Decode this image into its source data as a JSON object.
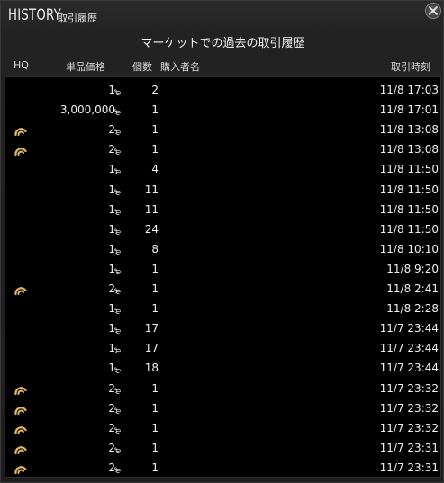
{
  "window": {
    "title": "HISTORY",
    "subtitle": "取引履歴",
    "heading": "マーケットでの過去の取引履歴"
  },
  "columns": {
    "hq": "HQ",
    "price": "単品価格",
    "quantity": "個数",
    "buyer": "購入者名",
    "date": "取引時刻"
  },
  "currency_symbol": "₻",
  "rows": [
    {
      "hq": false,
      "price": "1",
      "qty": "2",
      "date": "11/8 17:03"
    },
    {
      "hq": false,
      "price": "3,000,000",
      "qty": "1",
      "date": "11/8 17:01"
    },
    {
      "hq": true,
      "price": "2",
      "qty": "1",
      "date": "11/8 13:08"
    },
    {
      "hq": true,
      "price": "2",
      "qty": "1",
      "date": "11/8 13:08"
    },
    {
      "hq": false,
      "price": "1",
      "qty": "4",
      "date": "11/8 11:50"
    },
    {
      "hq": false,
      "price": "1",
      "qty": "11",
      "date": "11/8 11:50"
    },
    {
      "hq": false,
      "price": "1",
      "qty": "11",
      "date": "11/8 11:50"
    },
    {
      "hq": false,
      "price": "1",
      "qty": "24",
      "date": "11/8 11:50"
    },
    {
      "hq": false,
      "price": "1",
      "qty": "8",
      "date": "11/8 10:10"
    },
    {
      "hq": false,
      "price": "1",
      "qty": "1",
      "date": "11/8 9:20"
    },
    {
      "hq": true,
      "price": "2",
      "qty": "1",
      "date": "11/8 2:41"
    },
    {
      "hq": false,
      "price": "1",
      "qty": "1",
      "date": "11/8 2:28"
    },
    {
      "hq": false,
      "price": "1",
      "qty": "17",
      "date": "11/7 23:44"
    },
    {
      "hq": false,
      "price": "1",
      "qty": "17",
      "date": "11/7 23:44"
    },
    {
      "hq": false,
      "price": "1",
      "qty": "18",
      "date": "11/7 23:44"
    },
    {
      "hq": true,
      "price": "2",
      "qty": "1",
      "date": "11/7 23:32"
    },
    {
      "hq": true,
      "price": "2",
      "qty": "1",
      "date": "11/7 23:32"
    },
    {
      "hq": true,
      "price": "2",
      "qty": "1",
      "date": "11/7 23:32"
    },
    {
      "hq": true,
      "price": "2",
      "qty": "1",
      "date": "11/7 23:31"
    },
    {
      "hq": true,
      "price": "2",
      "qty": "1",
      "date": "11/7 23:31"
    }
  ],
  "colors": {
    "hq_icon": "#e0b866",
    "text": "#f0f0f0",
    "background": "#000000"
  },
  "icons": {
    "close": "close-icon",
    "hq": "hq-icon"
  }
}
